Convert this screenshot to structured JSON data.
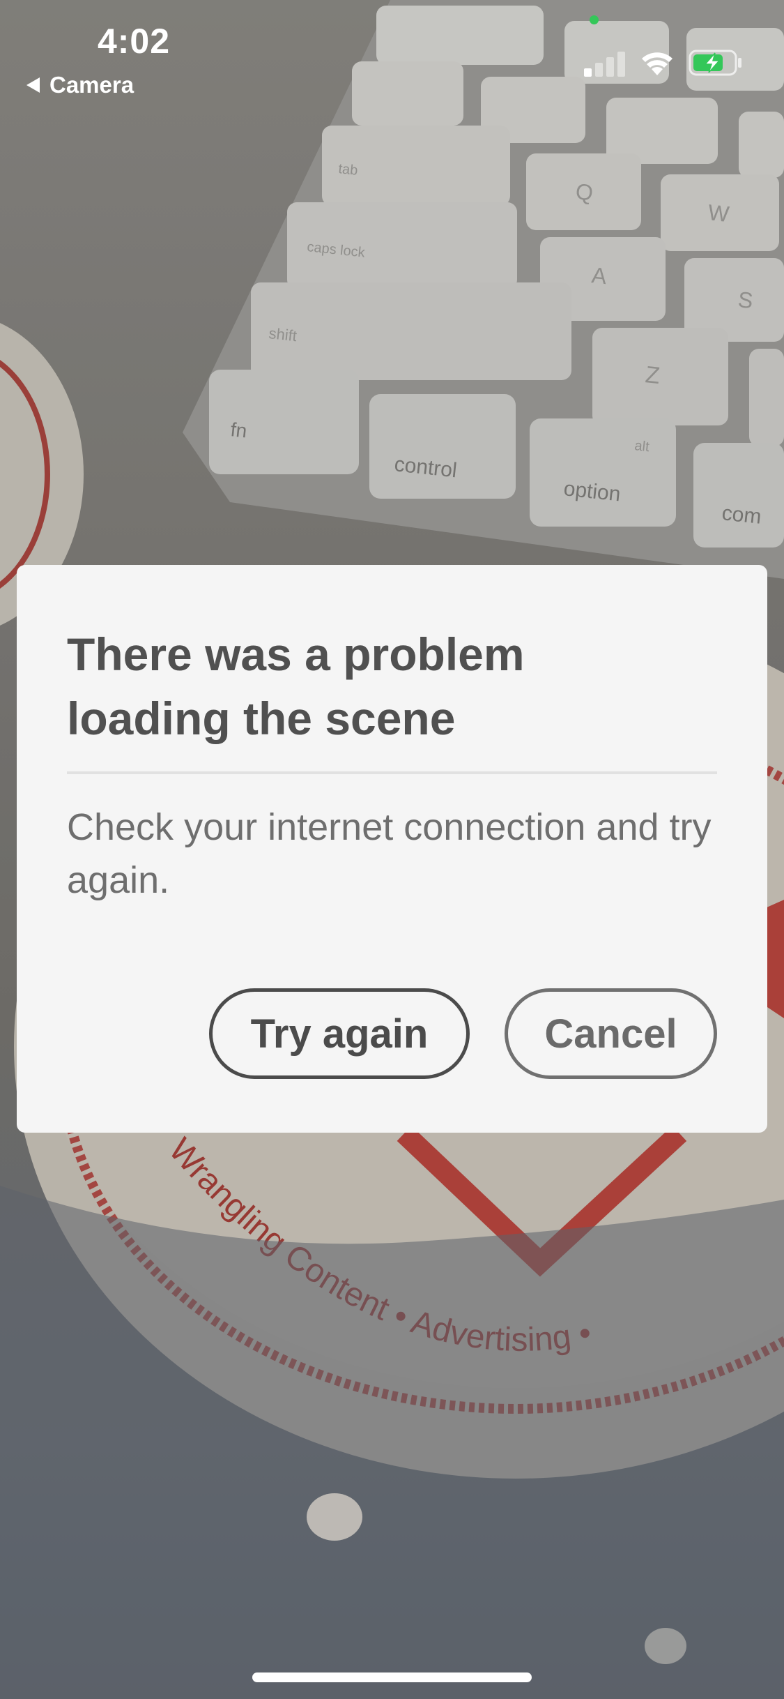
{
  "status_bar": {
    "time": "4:02",
    "back_app": "Camera",
    "icons": [
      "back-arrow-icon",
      "cellular-signal-icon",
      "wifi-icon",
      "battery-charging-icon"
    ],
    "mic_indicator_color": "#34c759"
  },
  "camera_scene": {
    "visible_text": [
      "fn",
      "control",
      "option",
      "com",
      "shift",
      "caps lock",
      "tab",
      "A",
      "S",
      "Q",
      "W",
      "Z",
      "alt",
      "Wrangling Content • Advertising •"
    ]
  },
  "dialog": {
    "title": "There was a problem loading the scene",
    "message": "Check your internet connection and try again.",
    "buttons": {
      "try_again": "Try again",
      "cancel": "Cancel"
    }
  },
  "colors": {
    "dialog_background": "#f5f5f5",
    "title_text": "#505050",
    "body_text": "#6e6e6e",
    "primary_button_border": "#4b4b4b",
    "secondary_button_border": "#707070",
    "logo_red": "#c23a33"
  }
}
